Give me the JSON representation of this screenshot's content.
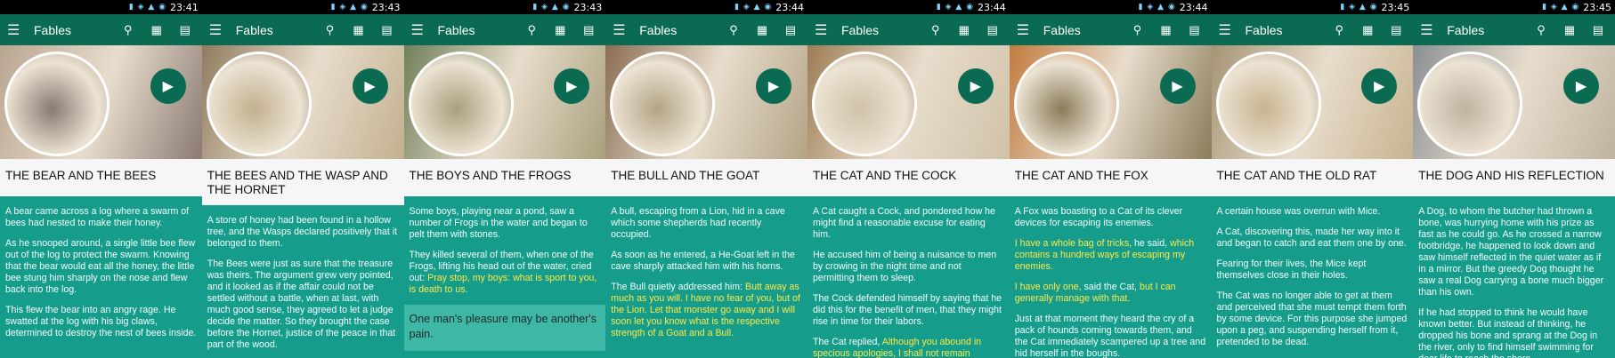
{
  "app_title": "Fables",
  "icons": {
    "menu": "menu-icon",
    "search": "search-icon",
    "grid": "grid-icon",
    "book": "book-icon",
    "play": "play-icon"
  },
  "colors": {
    "appbar": "#0a6b52",
    "body": "#169c8a",
    "highlight": "#ffe94a",
    "title_bg": "#f6f6f6"
  },
  "panels": [
    {
      "time": "23:41",
      "title": "THE BEAR AND THE BEES",
      "paragraphs": [
        [
          {
            "t": "A bear came across a log where a swarm of bees had nested to make their honey."
          }
        ],
        [
          {
            "t": "As he snooped around, a single little bee flew out of the log to protect the swarm. Knowing that the bear would eat all the honey, the little bee stung him sharply on the nose and flew back into the log."
          }
        ],
        [
          {
            "t": "This flew the bear into an angry rage. He swatted at the log with his big claws, determined to destroy the nest of bees inside."
          }
        ]
      ]
    },
    {
      "time": "23:43",
      "title": "THE BEES AND THE WASP AND THE HORNET",
      "paragraphs": [
        [
          {
            "t": "A store of honey had been found in a hollow tree, and the Wasps declared positively that it belonged to them."
          }
        ],
        [
          {
            "t": "The Bees were just as sure that the treasure was theirs. The argument grew very pointed, and it looked as if the affair could not be settled without a battle, when at last, with much good sense, they agreed to let a judge decide the matter. So they brought the case before the Hornet, justice of the peace in that part of the wood."
          }
        ]
      ]
    },
    {
      "time": "23:43",
      "title": "THE BOYS AND THE FROGS",
      "paragraphs": [
        [
          {
            "t": "Some boys, playing near a pond, saw a number of Frogs in the water and began to pelt them with stones."
          }
        ],
        [
          {
            "t": "They killed several of them, when one of the Frogs, lifting his head out of the water, cried out: "
          },
          {
            "t": "Pray stop, my boys: what is sport to you, is death to us.",
            "hl": true
          }
        ]
      ],
      "moral": "One man's pleasure may be another's pain."
    },
    {
      "time": "23:44",
      "title": "THE BULL AND THE GOAT",
      "paragraphs": [
        [
          {
            "t": "A bull, escaping from a Lion, hid in a cave which some shepherds had recently occupied."
          }
        ],
        [
          {
            "t": "As soon as he entered, a He-Goat left in the cave sharply attacked him with his horns."
          }
        ],
        [
          {
            "t": "The Bull quietly addressed him: "
          },
          {
            "t": "Butt away as much as you will. I have no fear of you, but of the Lion. Let that monster go away and I will soon let you know what is the respective strength of a Goat and a Bull.",
            "hl": true
          }
        ]
      ]
    },
    {
      "time": "23:44",
      "title": "THE CAT AND THE COCK",
      "paragraphs": [
        [
          {
            "t": "A Cat caught a Cock, and pondered how he might find a reasonable excuse for eating him."
          }
        ],
        [
          {
            "t": "He accused him of being a nuisance to men by crowing in the night time and not permitting them to sleep."
          }
        ],
        [
          {
            "t": "The Cock defended himself by saying that he did this for the benefit of men, that they might rise in time for their labors."
          }
        ],
        [
          {
            "t": "The Cat replied, "
          },
          {
            "t": "Although you abound in specious apologies, I shall not remain supperless;",
            "hl": true
          }
        ]
      ]
    },
    {
      "time": "23:44",
      "title": "THE CAT AND THE FOX",
      "paragraphs": [
        [
          {
            "t": "A Fox was boasting to a Cat of its clever devices for escaping its enemies."
          }
        ],
        [
          {
            "t": "I have a whole bag of tricks,",
            "hl": true
          },
          {
            "t": " he said, "
          },
          {
            "t": "which contains a hundred ways of escaping my enemies.",
            "hl": true
          }
        ],
        [
          {
            "t": "I have only one,",
            "hl": true
          },
          {
            "t": " said the Cat, "
          },
          {
            "t": "but I can generally manage with that.",
            "hl": true
          }
        ],
        [
          {
            "t": "Just at that moment they heard the cry of a pack of hounds coming towards them, and the Cat immediately scampered up a tree and hid herself in the boughs."
          }
        ]
      ]
    },
    {
      "time": "23:45",
      "title": "THE CAT AND THE OLD RAT",
      "paragraphs": [
        [
          {
            "t": "A certain house was overrun with Mice."
          }
        ],
        [
          {
            "t": "A Cat, discovering this, made her way into it and began to catch and eat them one by one."
          }
        ],
        [
          {
            "t": "Fearing for their lives, the Mice kept themselves close in their holes."
          }
        ],
        [
          {
            "t": "The Cat was no longer able to get at them and perceived that she must tempt them forth by some device. For this purpose she jumped upon a peg, and suspending herself from it, pretended to be dead."
          }
        ]
      ]
    },
    {
      "time": "23:45",
      "title": "THE DOG AND HIS REFLECTION",
      "paragraphs": [
        [
          {
            "t": "A Dog, to whom the butcher had thrown a bone, was hurrying home with his prize as fast as he could go. As he crossed a narrow footbridge, he happened to look down and saw himself reflected in the quiet water as if in a mirror. But the greedy Dog thought he saw a real Dog carrying a bone much bigger than his own."
          }
        ],
        [
          {
            "t": "If he had stopped to think he would have known better. But instead of thinking, he dropped his bone and sprang at the Dog in the river, only to find himself swimming for dear life to reach the shore."
          }
        ]
      ]
    }
  ]
}
